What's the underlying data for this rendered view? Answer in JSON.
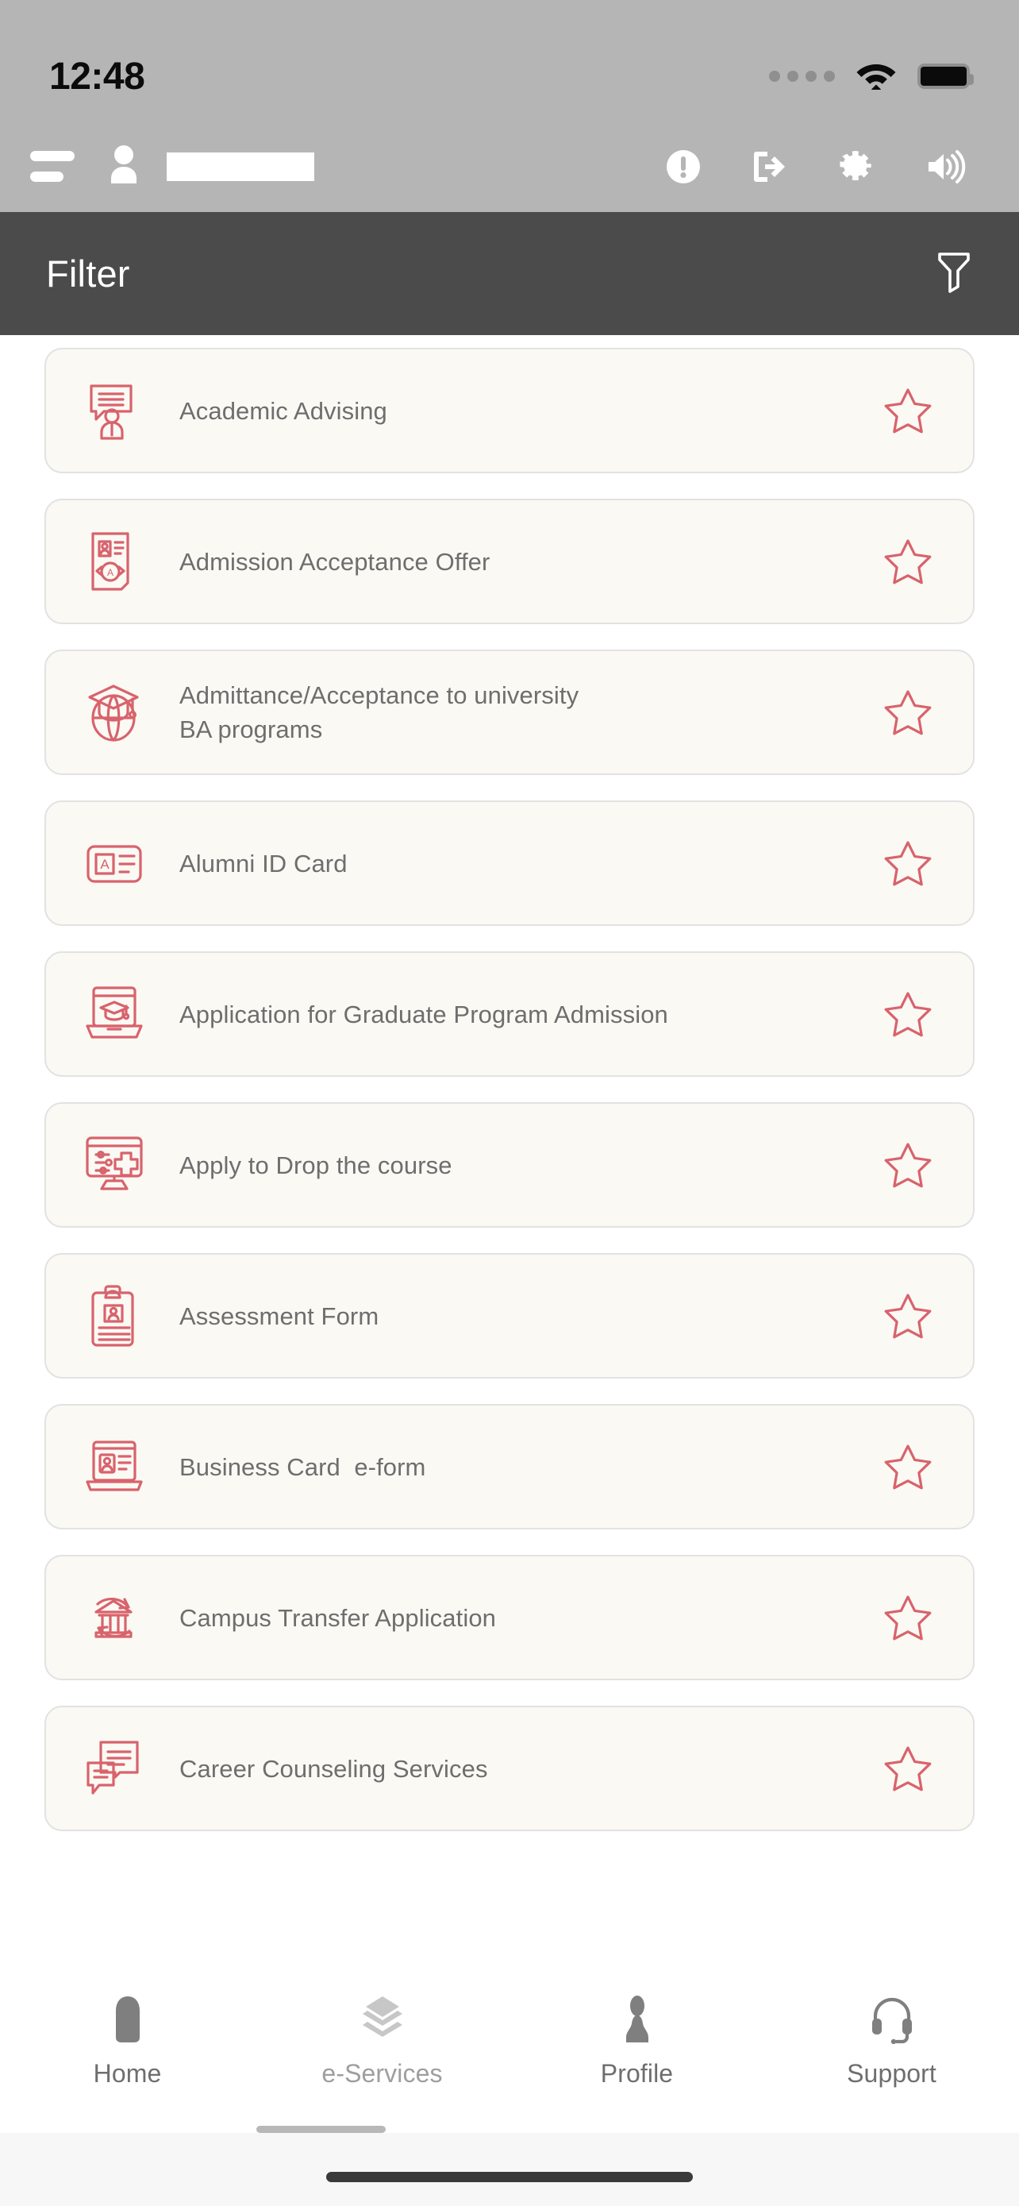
{
  "status_bar": {
    "time": "12:48",
    "signal_icon": "signal-dots-icon",
    "wifi_icon": "wifi-icon",
    "battery_icon": "battery-full-icon"
  },
  "app_bar": {
    "menu_icon": "hamburger-menu-icon",
    "avatar_icon": "user-avatar-icon",
    "user_name": "",
    "actions": [
      {
        "name": "info-alert-icon",
        "label": "Alerts"
      },
      {
        "name": "logout-icon",
        "label": "Logout"
      },
      {
        "name": "settings-gear-icon",
        "label": "Settings"
      },
      {
        "name": "volume-speaker-icon",
        "label": "Sound"
      }
    ]
  },
  "filter_bar": {
    "label": "Filter",
    "icon": "filter-funnel-icon"
  },
  "colors": {
    "accent_red": "#d8636c",
    "status_bar_bg": "#b5b5b5",
    "filter_bar_bg": "#4b4b4b",
    "card_bg": "#fbf9f4",
    "card_border": "#e2e2e2",
    "card_text": "#6e6e6e"
  },
  "services": [
    {
      "title": "Academic Advising",
      "icon": "chat-advising-icon",
      "favorite": false
    },
    {
      "title": "Admission Acceptance Offer",
      "icon": "certificate-award-icon",
      "favorite": false
    },
    {
      "title": "Admittance/Acceptance to university\nBA programs",
      "icon": "graduation-globe-icon",
      "favorite": false
    },
    {
      "title": "Alumni ID Card",
      "icon": "id-badge-icon",
      "favorite": false
    },
    {
      "title": "Application for Graduate Program Admission",
      "icon": "laptop-graduation-icon",
      "favorite": false
    },
    {
      "title": "Apply to Drop the course",
      "icon": "monitor-settings-icon",
      "favorite": false
    },
    {
      "title": "Assessment Form",
      "icon": "clipboard-form-icon",
      "favorite": false
    },
    {
      "title": "Business Card  e-form",
      "icon": "business-card-icon",
      "favorite": false
    },
    {
      "title": "Campus Transfer Application",
      "icon": "campus-transfer-icon",
      "favorite": false
    },
    {
      "title": "Career Counseling Services",
      "icon": "speech-bubbles-icon",
      "favorite": false
    }
  ],
  "bottom_nav": {
    "active": "e-Services",
    "items": [
      {
        "label": "Home",
        "icon": "home-icon"
      },
      {
        "label": "e-Services",
        "icon": "layers-icon"
      },
      {
        "label": "Profile",
        "icon": "person-icon"
      },
      {
        "label": "Support",
        "icon": "headset-icon"
      }
    ]
  }
}
